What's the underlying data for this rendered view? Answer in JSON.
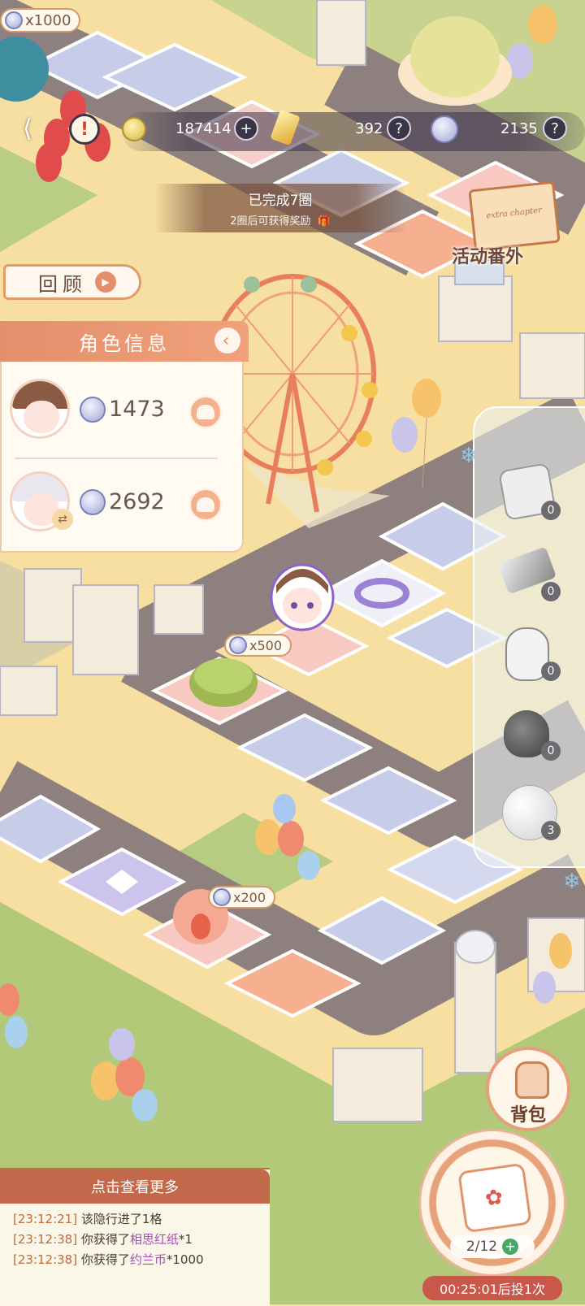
{
  "event_reward_badge": "x1000",
  "currency": {
    "stamina": "187414",
    "gems": "392",
    "tokens": "2135"
  },
  "laps": {
    "completed": "已完成7圈",
    "next_reward": "2圈后可获得奖励"
  },
  "review_label": "回顾",
  "event_extra": {
    "label": "活动番外",
    "script": "extra chapter"
  },
  "character_panel": {
    "title": "角色信息",
    "characters": [
      {
        "coins": "1473"
      },
      {
        "coins": "2692"
      }
    ]
  },
  "board_rewards": {
    "tile_a": "x500",
    "tile_b": "x200"
  },
  "items": [
    {
      "name": "dice",
      "count": "0"
    },
    {
      "name": "shovel",
      "count": "0"
    },
    {
      "name": "glove",
      "count": "0"
    },
    {
      "name": "pouch",
      "count": "0"
    },
    {
      "name": "snowball",
      "count": "3"
    }
  ],
  "backpack_label": "背包",
  "log": {
    "header": "点击查看更多",
    "lines": [
      {
        "time": "[23:12:21]",
        "text": "该隐行进了1格",
        "item": "",
        "suffix": ""
      },
      {
        "time": "[23:12:38]",
        "text": "你获得了",
        "item": "相思红纸",
        "suffix": "*1"
      },
      {
        "time": "[23:12:38]",
        "text": "你获得了",
        "item": "约兰币",
        "suffix": "*1000"
      }
    ]
  },
  "roll": {
    "count": "2/12",
    "timer": "00:25:01后投1次"
  },
  "colors": {
    "grass": "#b3c97a",
    "road": "#8b7f7e",
    "plaza": "#f6dfa0",
    "accent": "#e38f6c"
  }
}
